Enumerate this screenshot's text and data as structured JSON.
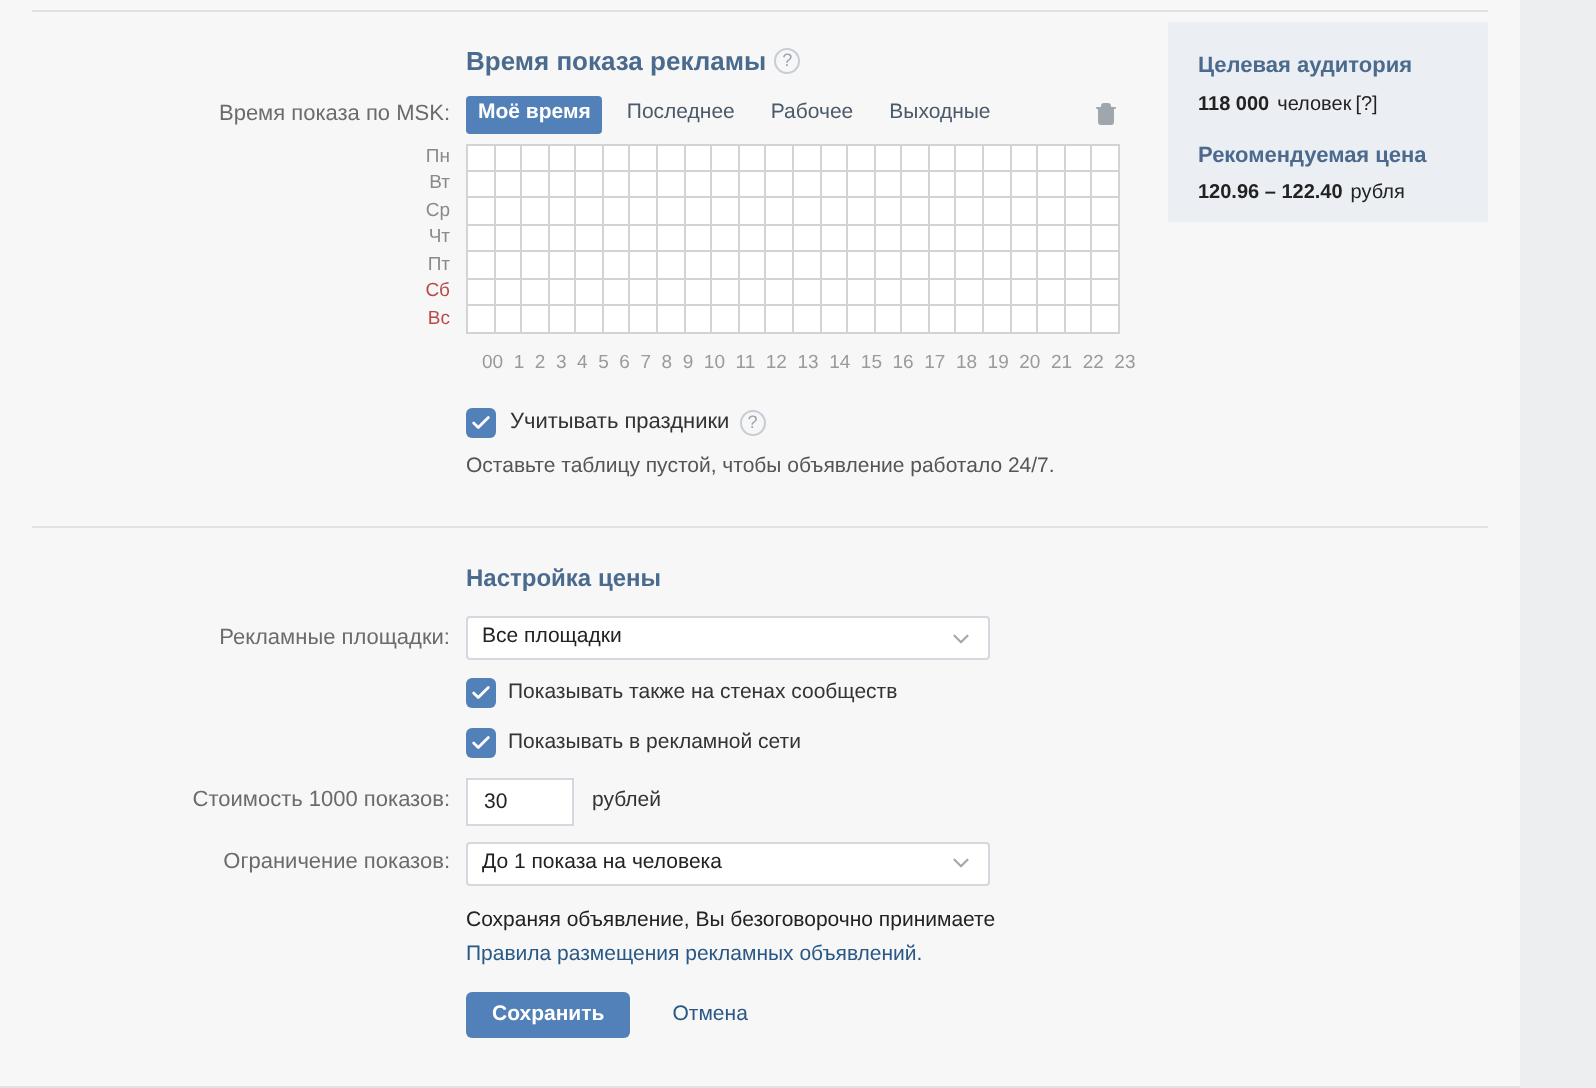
{
  "schedule": {
    "title": "Время показа рекламы",
    "help": "?",
    "timezone_label": "Время показа по MSK:",
    "presets": [
      {
        "label": "Моё время",
        "selected": true
      },
      {
        "label": "Последнее",
        "selected": false
      },
      {
        "label": "Рабочее",
        "selected": false
      },
      {
        "label": "Выходные",
        "selected": false
      }
    ],
    "days": [
      {
        "label": "Пн",
        "color": "#8a8a8a"
      },
      {
        "label": "Вт",
        "color": "#8a8a8a"
      },
      {
        "label": "Ср",
        "color": "#8a8a8a"
      },
      {
        "label": "Чт",
        "color": "#8a8a8a"
      },
      {
        "label": "Пт",
        "color": "#8a8a8a"
      },
      {
        "label": "Сб",
        "color": "#b94a48"
      },
      {
        "label": "Вс",
        "color": "#b94a48"
      }
    ],
    "hours": [
      "00",
      "1",
      "2",
      "3",
      "4",
      "5",
      "6",
      "7",
      "8",
      "9",
      "10",
      "11",
      "12",
      "13",
      "14",
      "15",
      "16",
      "17",
      "18",
      "19",
      "20",
      "21",
      "22",
      "23"
    ],
    "holidays": {
      "label": "Учитывать праздники",
      "checked": true,
      "help": "?"
    },
    "note": "Оставьте таблицу пустой, чтобы объявление работало 24/7."
  },
  "summary": {
    "audience_title": "Целевая аудитория",
    "audience_count": "118 000",
    "audience_unit": "человек",
    "audience_help": "[?]",
    "price_title": "Рекомендуемая цена",
    "price_range": "120.96 – 122.40",
    "price_unit": "рубля"
  },
  "pricing": {
    "title": "Настройка цены",
    "platforms_label": "Рекламные площадки:",
    "platforms_value": "Все площадки",
    "options": [
      {
        "label": "Показывать также на стенах сообществ",
        "checked": true
      },
      {
        "label": "Показывать в рекламной сети",
        "checked": true
      }
    ],
    "cost_label": "Стоимость 1000 показов:",
    "cost_value": "30",
    "cost_unit": "рублей",
    "limit_label": "Ограничение показов:",
    "limit_value": "До 1 показа на человека",
    "terms": "Сохраняя объявление, Вы безоговорочно принимаете",
    "terms_link": "Правила размещения рекламных объявлений.",
    "save": "Сохранить",
    "cancel": "Отмена"
  }
}
